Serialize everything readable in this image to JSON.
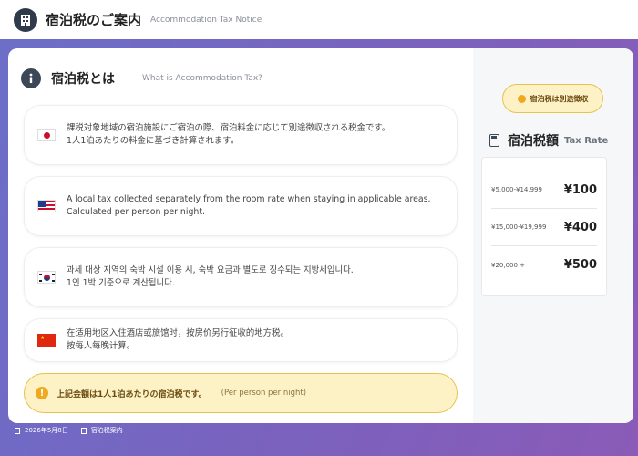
{
  "header": {
    "title": "宿泊税のご案内",
    "subtitle": "Accommodation Tax Notice",
    "icon": "building-icon"
  },
  "section": {
    "title": "宿泊税とは",
    "subtitle": "What is Accommodation Tax?",
    "icon": "info-icon"
  },
  "items": [
    {
      "flag": "japan-flag-icon",
      "lines": [
        "課税対象地域の宿泊施設にご宿泊の際、宿泊料金に応じて別途徴収される税金です。",
        "1人1泊あたりの料金に基づき計算されます。"
      ]
    },
    {
      "flag": "usa-flag-icon",
      "lines": [
        "A local tax collected separately from the room rate when staying in applicable areas.",
        "Calculated per person per night."
      ]
    },
    {
      "flag": "korea-flag-icon",
      "lines": [
        "과세 대상 지역의 숙박 시설 이용 시, 숙박 요금과 별도로 징수되는 지방세입니다.",
        "1인 1박 기준으로 계산됩니다."
      ]
    },
    {
      "flag": "china-flag-icon",
      "lines": [
        "在适用地区入住酒店或旅馆时，按房价另行征收的地方税。",
        "按每人每晚计算。"
      ]
    }
  ],
  "notice": {
    "text": "上記金額は1人1泊あたりの宿泊税です。",
    "sub": "(Per person per night)"
  },
  "badge": {
    "text": "宿泊税は別途徴収"
  },
  "rates": {
    "title": "宿泊税額",
    "subtitle": "Tax Rate",
    "rows": [
      {
        "range": "¥5,000-¥14,999",
        "amount": "¥100"
      },
      {
        "range": "¥15,000-¥19,999",
        "amount": "¥400"
      },
      {
        "range": "¥20,000 +",
        "amount": "¥500"
      }
    ]
  },
  "footer": {
    "date": "2026年5月8日",
    "doc": "宿泊税案内"
  },
  "colors": {
    "accent": "#e8c24a",
    "dark": "#2f3a4b"
  }
}
